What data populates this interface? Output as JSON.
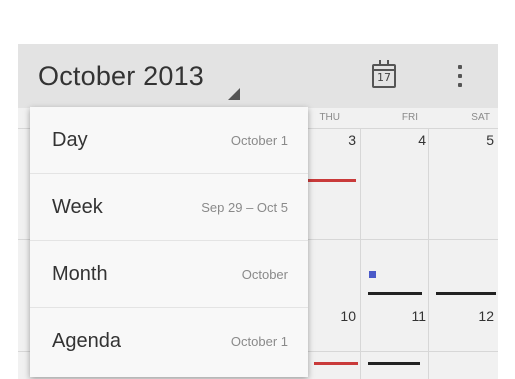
{
  "appbar": {
    "title": "October 2013",
    "today_icon_text": "17",
    "icons": {
      "today": "calendar-today-icon",
      "overflow": "overflow-menu-icon",
      "caret": "dropdown-caret-icon"
    }
  },
  "calendar": {
    "weekday_headers": [
      "THU",
      "FRI",
      "SAT"
    ],
    "week1_days": [
      "3",
      "4",
      "5"
    ],
    "week2_days": [
      "10",
      "11",
      "12"
    ],
    "accent_color": "#c93a3a",
    "event_color": "#4a5ac8"
  },
  "view_menu": {
    "items": [
      {
        "label": "Day",
        "sub": "October 1"
      },
      {
        "label": "Week",
        "sub": "Sep 29 – Oct 5"
      },
      {
        "label": "Month",
        "sub": "October"
      },
      {
        "label": "Agenda",
        "sub": "October 1"
      }
    ]
  }
}
